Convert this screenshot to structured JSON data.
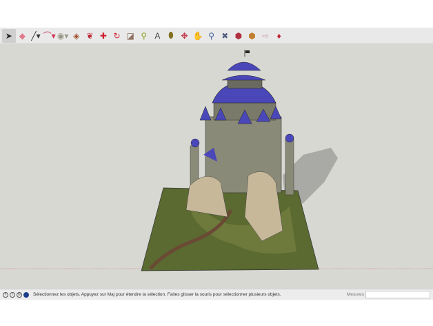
{
  "toolbar": {
    "tools": [
      {
        "name": "select",
        "glyph": "➤",
        "color": "#222"
      },
      {
        "name": "eraser",
        "glyph": "◆",
        "color": "#e07a8a"
      },
      {
        "name": "pencil-line",
        "glyph": "╱▾",
        "color": "#333"
      },
      {
        "name": "arc",
        "glyph": "⌒▾",
        "color": "#d03050"
      },
      {
        "name": "shapes",
        "glyph": "◉▾",
        "color": "#998"
      },
      {
        "name": "push-pull",
        "glyph": "◈",
        "color": "#a05030"
      },
      {
        "name": "follow-me",
        "glyph": "❦",
        "color": "#c02030"
      },
      {
        "name": "move",
        "glyph": "✚",
        "color": "#d02030"
      },
      {
        "name": "rotate",
        "glyph": "↻",
        "color": "#d02030"
      },
      {
        "name": "scale",
        "glyph": "◪",
        "color": "#907060"
      },
      {
        "name": "tape-measure",
        "glyph": "⚲",
        "color": "#90a020"
      },
      {
        "name": "text",
        "glyph": "A",
        "color": "#444"
      },
      {
        "name": "paint-bucket",
        "glyph": "⬮",
        "color": "#807020"
      },
      {
        "name": "orbit",
        "glyph": "✥",
        "color": "#c03040"
      },
      {
        "name": "pan",
        "glyph": "✋",
        "color": "#d0c060"
      },
      {
        "name": "zoom",
        "glyph": "⚲",
        "color": "#4060a0"
      },
      {
        "name": "zoom-extents",
        "glyph": "✖",
        "color": "#506080"
      },
      {
        "name": "3d-warehouse",
        "glyph": "⬢",
        "color": "#b03040"
      },
      {
        "name": "extension-warehouse",
        "glyph": "⬢",
        "color": "#c08030"
      },
      {
        "name": "send-to-layout",
        "glyph": "⇨",
        "color": "#d0a0b0"
      },
      {
        "name": "extension-manager",
        "glyph": "♦",
        "color": "#c02030"
      }
    ]
  },
  "status": {
    "icons": [
      "info",
      "geolocation",
      "credits",
      "user"
    ],
    "message": "Sélectionnez les objets. Appuyez sur Maj pour étendre la sélection. Faites glisser la souris pour sélectionner plusieurs objets.",
    "measures_label": "Mesures",
    "measures_value": ""
  },
  "colors": {
    "roof": "#4a48b8",
    "stone": "#8a8a78",
    "grass": "#5a6a30",
    "axis_red": "#d08080"
  }
}
